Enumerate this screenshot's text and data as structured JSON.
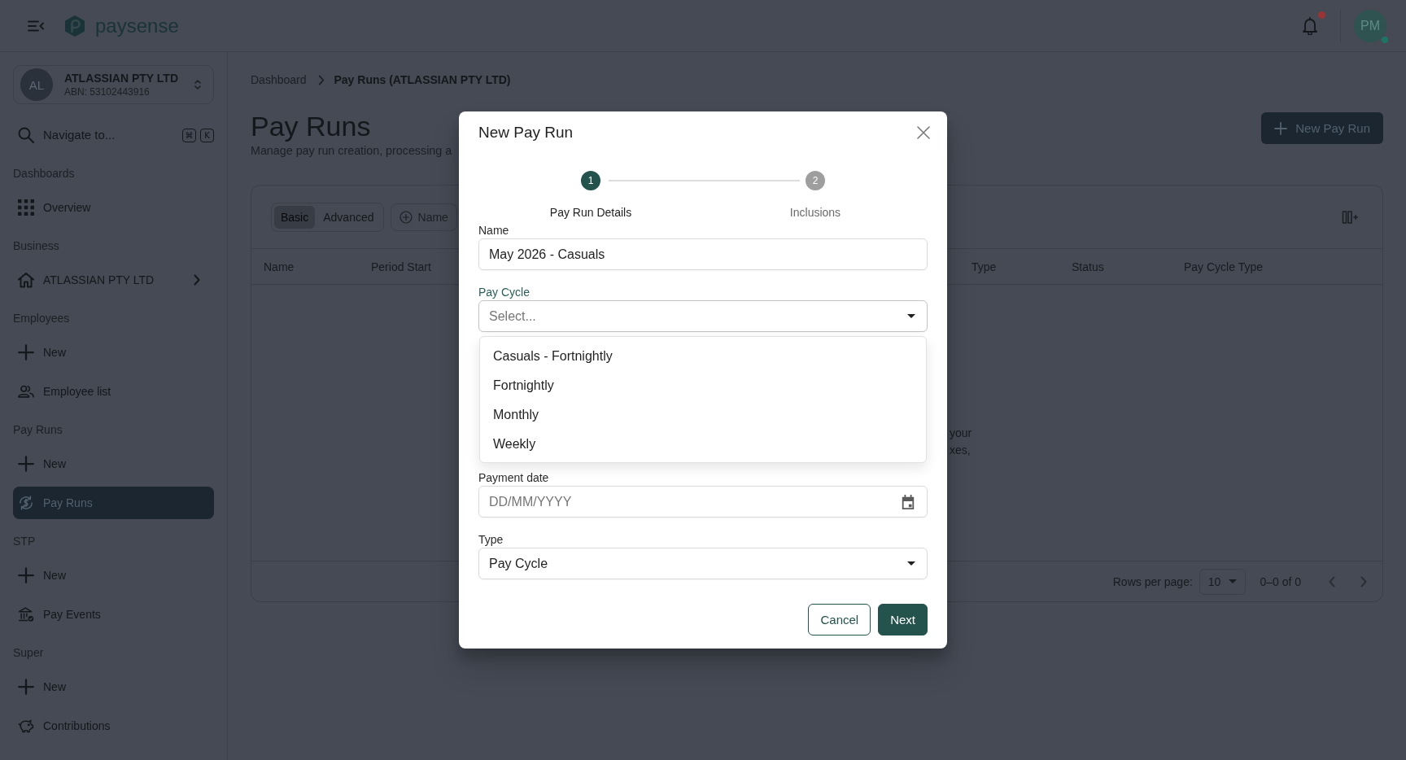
{
  "topbar": {
    "brand": "paysense",
    "notifications": {
      "unread": true
    },
    "user": {
      "initials": "PM",
      "online": true
    }
  },
  "sidebar": {
    "company": {
      "initials": "AL",
      "name": "ATLASSIAN PTY LTD",
      "abn": "ABN: 53102443916"
    },
    "search": {
      "placeholder": "Navigate to...",
      "keys": [
        "⌘",
        "K"
      ]
    },
    "sections": [
      {
        "title": "Dashboards",
        "items": [
          {
            "kind": "dashboard",
            "label": "Overview",
            "selected": false,
            "submenu": false
          }
        ]
      },
      {
        "title": "Business",
        "items": [
          {
            "kind": "business",
            "label": "ATLASSIAN PTY LTD",
            "selected": false,
            "submenu": true
          }
        ]
      },
      {
        "title": "Employees",
        "items": [
          {
            "kind": "add",
            "label": "New",
            "selected": false,
            "submenu": false
          },
          {
            "kind": "employees",
            "label": "Employee list",
            "selected": false,
            "submenu": false
          }
        ]
      },
      {
        "title": "Pay Runs",
        "items": [
          {
            "kind": "add",
            "label": "New",
            "selected": false,
            "submenu": false
          },
          {
            "kind": "payruns",
            "label": "Pay Runs",
            "selected": true,
            "submenu": false
          }
        ]
      },
      {
        "title": "STP",
        "items": [
          {
            "kind": "add",
            "label": "New",
            "selected": false,
            "submenu": false
          },
          {
            "kind": "events",
            "label": "Pay Events",
            "selected": false,
            "submenu": false
          }
        ]
      },
      {
        "title": "Super",
        "items": [
          {
            "kind": "add",
            "label": "New",
            "selected": false,
            "submenu": false
          },
          {
            "kind": "super",
            "label": "Contributions",
            "selected": false,
            "submenu": false
          }
        ]
      }
    ]
  },
  "main": {
    "breadcrumb": [
      {
        "label": "Dashboard",
        "current": false
      },
      {
        "label": "Pay Runs (ATLASSIAN PTY LTD)",
        "current": true
      }
    ],
    "title": "Pay Runs",
    "subtitle": "Manage pay run creation, processing a",
    "action": {
      "label": "New Pay Run"
    },
    "table": {
      "views": [
        {
          "label": "Basic",
          "selected": true
        },
        {
          "label": "Advanced",
          "selected": false
        }
      ],
      "filters": [
        {
          "label": "Name"
        }
      ],
      "columns": [
        "Name",
        "Period Start",
        "Type",
        "Status",
        "Pay Cycle Type"
      ],
      "empty_state": [
        "your",
        "xes,"
      ],
      "footer": {
        "rows_per_page_label": "Rows per page:",
        "rows_per_page": "10",
        "range": "0–0 of 0",
        "previous": {
          "disabled": true
        },
        "next": {
          "disabled": true
        }
      }
    }
  },
  "dialog": {
    "title": "New Pay Run",
    "steps": [
      {
        "number": "1",
        "label": "Pay Run Details",
        "active": true
      },
      {
        "number": "2",
        "label": "Inclusions",
        "active": false
      }
    ],
    "fields": [
      {
        "kind": "text",
        "label": "Name",
        "value": "May 2026 - Casuals",
        "focused": false
      },
      {
        "kind": "select",
        "label": "Pay Cycle",
        "placeholder": "Select...",
        "focused": true,
        "expanded": true,
        "options": [
          {
            "label": "Casuals - Fortnightly",
            "selected": false
          },
          {
            "label": "Fortnightly",
            "selected": false
          },
          {
            "label": "Monthly",
            "selected": false
          },
          {
            "label": "Weekly",
            "selected": false
          }
        ]
      },
      {
        "kind": "date",
        "label": "Payment date",
        "placeholder": "DD/MM/YYYY",
        "focused": false
      },
      {
        "kind": "select",
        "label": "Type",
        "value": "Pay Cycle",
        "focused": false,
        "expanded": false
      }
    ],
    "buttons": [
      {
        "kind": "outlined",
        "label": "Cancel"
      },
      {
        "kind": "filled",
        "label": "Next"
      }
    ]
  }
}
